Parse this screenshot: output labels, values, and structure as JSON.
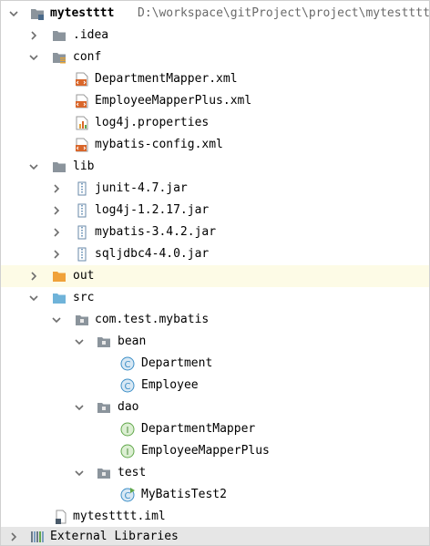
{
  "project": {
    "name": "mytestttt",
    "path": "D:\\workspace\\gitProject\\project\\mytestttt"
  },
  "tree": {
    "idea": ".idea",
    "conf": "conf",
    "conf_files": [
      "DepartmentMapper.xml",
      "EmployeeMapperPlus.xml",
      "log4j.properties",
      "mybatis-config.xml"
    ],
    "lib": "lib",
    "lib_files": [
      "junit-4.7.jar",
      "log4j-1.2.17.jar",
      "mybatis-3.4.2.jar",
      "sqljdbc4-4.0.jar"
    ],
    "out": "out",
    "src": "src",
    "package": "com.test.mybatis",
    "bean": "bean",
    "bean_classes": [
      "Department",
      "Employee"
    ],
    "dao": "dao",
    "dao_interfaces": [
      "DepartmentMapper",
      "EmployeeMapperPlus"
    ],
    "test": "test",
    "test_classes": [
      "MyBatisTest2"
    ],
    "iml": "mytestttt.iml",
    "external": "External Libraries"
  },
  "colors": {
    "selected_row": "#fdfbe6",
    "external_row": "#e6e6e6",
    "folder_gray": "#8b949c",
    "folder_orange": "#f0a23a",
    "folder_blue": "#6fb3d9",
    "class_circle": "#3d8fc7",
    "interface_circle": "#62a84b"
  }
}
